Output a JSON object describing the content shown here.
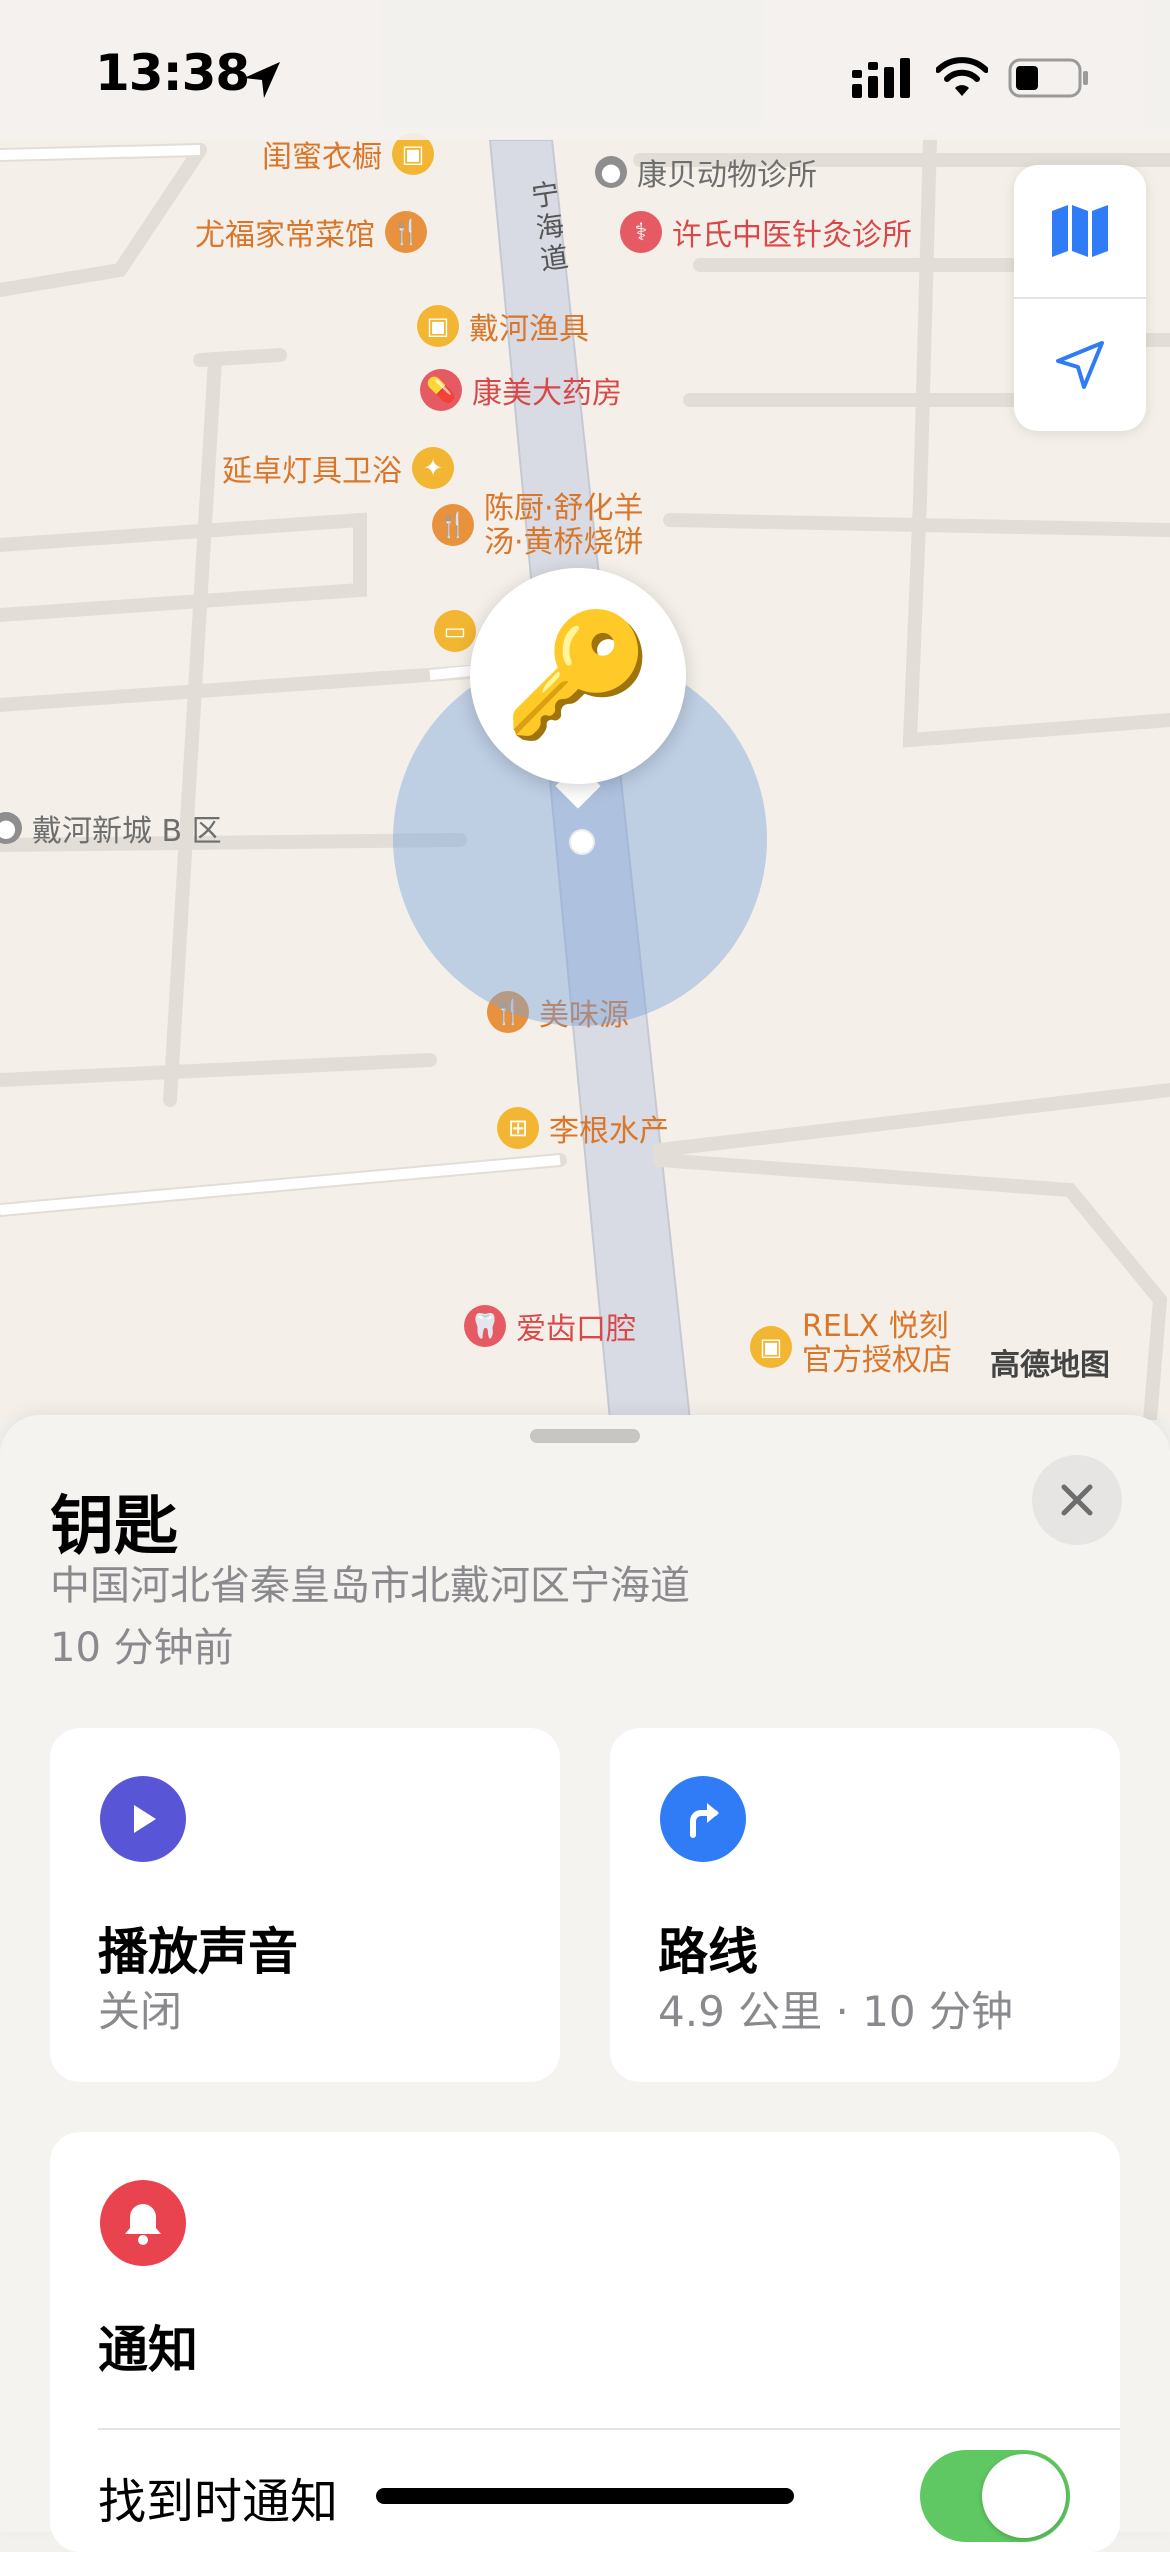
{
  "status_bar": {
    "time": "13:38"
  },
  "map": {
    "road_label": "宁海道",
    "pois": [
      {
        "name": "闺蜜衣橱"
      },
      {
        "name": "康贝动物诊所"
      },
      {
        "name": "尤福家常菜馆"
      },
      {
        "name": "许氏中医针灸诊所"
      },
      {
        "name": "戴河渔具"
      },
      {
        "name": "康美大药房"
      },
      {
        "name": "延卓灯具卫浴"
      },
      {
        "name": "陈厨·舒化羊",
        "line2": "汤·黄桥烧饼"
      },
      {
        "name": "戴河新城 B 区"
      },
      {
        "name": "美味源"
      },
      {
        "name": "李根水产"
      },
      {
        "name": "爱齿口腔"
      },
      {
        "name": "RELX 悦刻",
        "line2": "官方授权店"
      }
    ],
    "attribution": "高德地图",
    "pin_emoji": "🔑"
  },
  "sheet": {
    "title": "钥匙",
    "address": "中国河北省秦皇岛市北戴河区宁海道",
    "time_ago": "10 分钟前",
    "play_sound": {
      "title": "播放声音",
      "subtitle": "关闭",
      "color": "#5856d6"
    },
    "directions": {
      "title": "路线",
      "subtitle": "4.9 公里 · 10 分钟",
      "color": "#2f7cf6"
    },
    "notifications": {
      "title": "通知",
      "color": "#e8434f",
      "notify_when_found": {
        "label": "找到时通知",
        "enabled": true
      }
    }
  }
}
